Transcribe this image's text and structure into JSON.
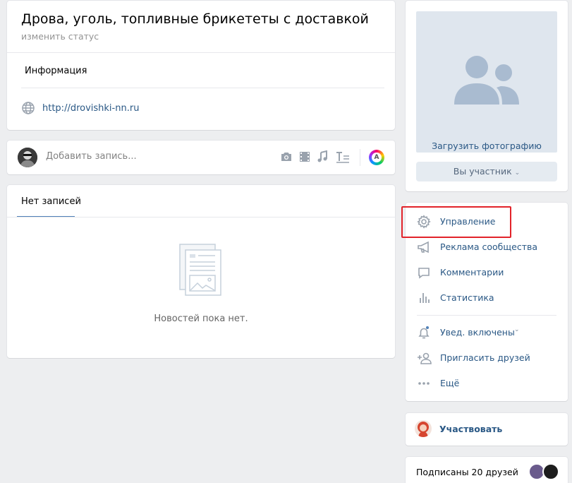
{
  "header": {
    "title": "Дрова, уголь, топливные брикететы с доставкой",
    "status_link": "изменить статус",
    "info_label": "Информация",
    "website": "http://drovishki-nn.ru"
  },
  "composer": {
    "placeholder": "Добавить запись..."
  },
  "wall": {
    "tab": "Нет записей",
    "empty_text": "Новостей пока нет."
  },
  "community": {
    "upload_photo": "Загрузить фотографию",
    "member_button": "Вы участник"
  },
  "menu": {
    "items": [
      {
        "label": "Управление",
        "icon": "gear-icon"
      },
      {
        "label": "Реклама сообщества",
        "icon": "megaphone-icon"
      },
      {
        "label": "Комментарии",
        "icon": "comment-icon"
      },
      {
        "label": "Статистика",
        "icon": "stats-icon"
      },
      {
        "label": "Увед. включены",
        "icon": "bell-icon"
      },
      {
        "label": "Пригласить друзей",
        "icon": "add-user-icon"
      },
      {
        "label": "Ещё",
        "icon": "more-icon"
      }
    ]
  },
  "participate": {
    "label": "Участвовать"
  },
  "friends": {
    "label": "Подписаны 20 друзей"
  },
  "colors": {
    "link": "#2a5885",
    "accent": "#5181b8",
    "highlight": "#e2232a",
    "background": "#edeef0"
  }
}
